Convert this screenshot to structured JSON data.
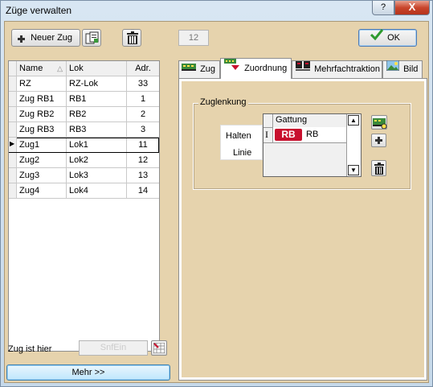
{
  "window": {
    "title": "Züge verwalten",
    "help_label": "?",
    "close_label": "X"
  },
  "toolbar": {
    "new_train_label": "Neuer Zug",
    "counter_value": "12",
    "ok_label": "OK"
  },
  "table": {
    "headers": {
      "name": "Name",
      "lok": "Lok",
      "adr": "Adr."
    },
    "rows": [
      {
        "name": "RZ",
        "lok": "RZ-Lok",
        "adr": "33"
      },
      {
        "name": "Zug RB1",
        "lok": "RB1",
        "adr": "1"
      },
      {
        "name": "Zug RB2",
        "lok": "RB2",
        "adr": "2"
      },
      {
        "name": "Zug RB3",
        "lok": "RB3",
        "adr": "3"
      },
      {
        "name": "Zug1",
        "lok": "Lok1",
        "adr": "11"
      },
      {
        "name": "Zug2",
        "lok": "Lok2",
        "adr": "12"
      },
      {
        "name": "Zug3",
        "lok": "Lok3",
        "adr": "13"
      },
      {
        "name": "Zug4",
        "lok": "Lok4",
        "adr": "14"
      }
    ],
    "selected_index": 4
  },
  "bottom": {
    "location_label": "Zug ist hier",
    "location_value": "SnfEin",
    "more_label": "Mehr >>"
  },
  "tabs": [
    {
      "label": "Zug"
    },
    {
      "label": "Zuordnung"
    },
    {
      "label": "Mehrfachtraktion"
    },
    {
      "label": "Bild"
    }
  ],
  "active_tab": 1,
  "zuglenkung": {
    "legend": "Zuglenkung",
    "side_labels": {
      "halten": "Halten",
      "linie": "Linie"
    },
    "column_header": "Gattung",
    "rows": [
      {
        "badge": "RB",
        "text": "RB"
      }
    ]
  },
  "colors": {
    "client_bg": "#e6d3ad",
    "badge_red": "#c8102e",
    "ok_check": "#2e9a2e"
  }
}
